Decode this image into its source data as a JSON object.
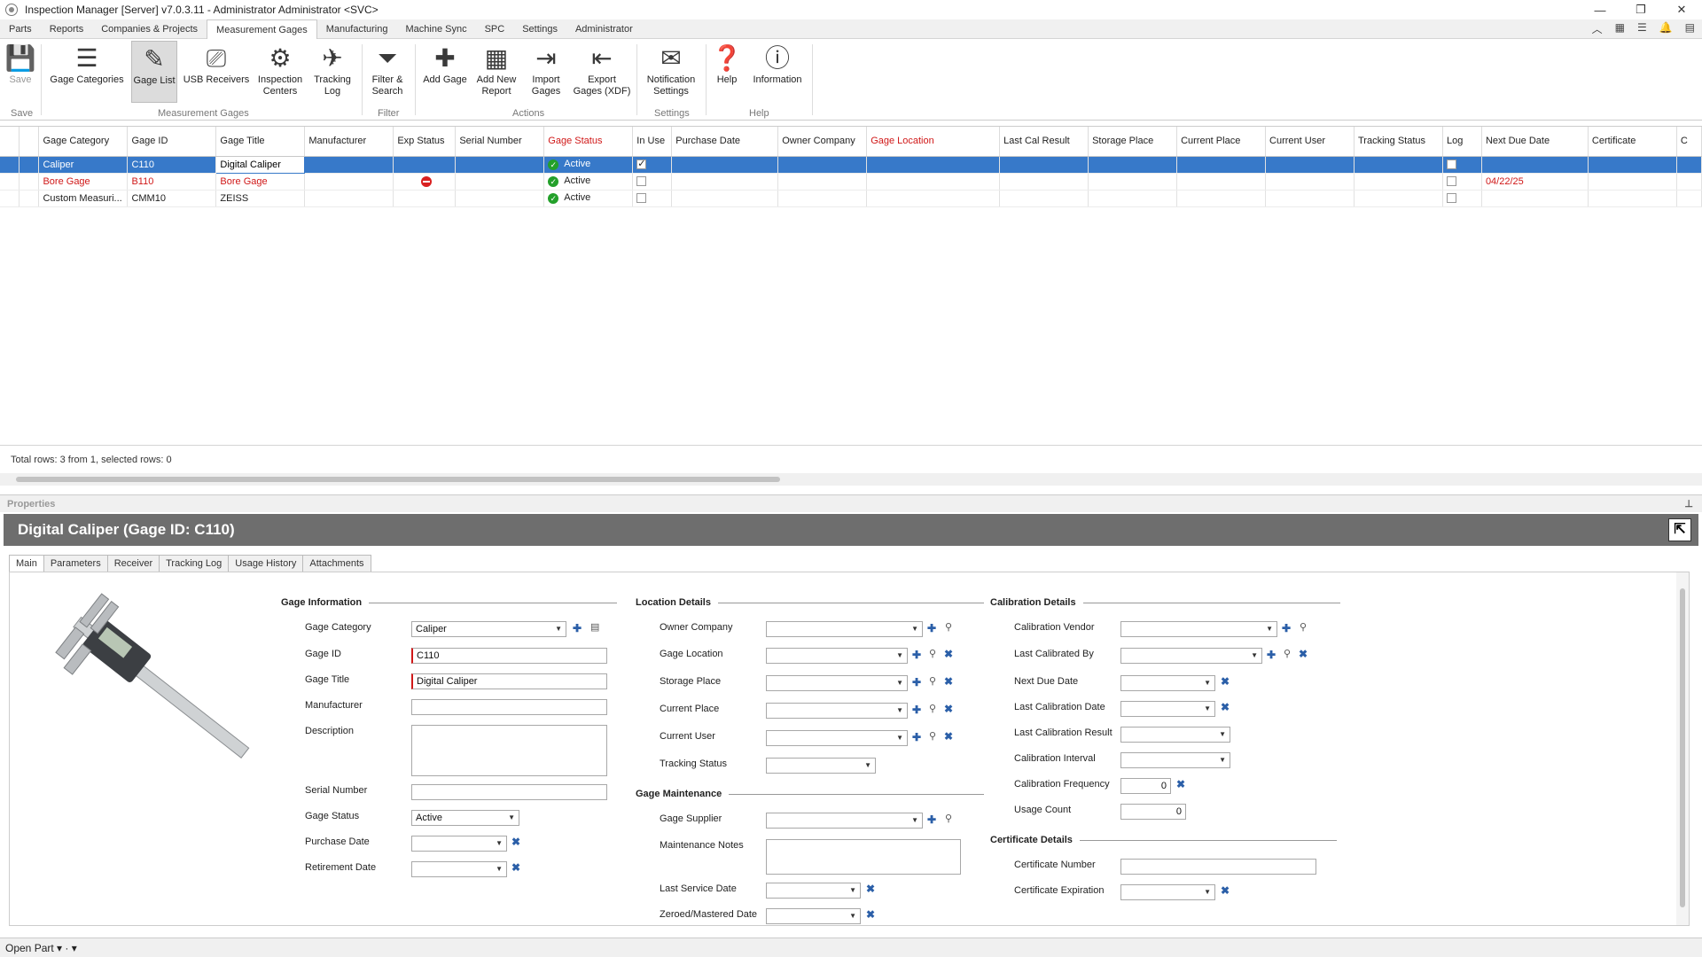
{
  "window": {
    "title": "Inspection Manager [Server] v7.0.3.11 - Administrator Administrator <SVC>",
    "controls": {
      "minimize": "—",
      "restore": "❐",
      "close": "✕"
    }
  },
  "menu": [
    "Parts",
    "Reports",
    "Companies & Projects",
    "Measurement Gages",
    "Manufacturing",
    "Machine Sync",
    "SPC",
    "Settings",
    "Administrator"
  ],
  "menu_active": "Measurement Gages",
  "quick_icons": [
    "︿",
    "▦",
    "☰",
    "🔔",
    "▤"
  ],
  "ribbon": {
    "buttons": {
      "save": "Save",
      "gage_categories": "Gage Categories",
      "gage_list": "Gage List",
      "usb_receivers": "USB Receivers",
      "inspection_centers": "Inspection Centers",
      "tracking_log": "Tracking Log",
      "filter_search": "Filter & Search",
      "add_gage": "Add Gage",
      "add_new_report": "Add New Report",
      "import_gages": "Import Gages",
      "export_gages": "Export Gages (XDF)",
      "notification_settings": "Notification Settings",
      "help": "Help",
      "information": "Information"
    },
    "groups": {
      "save": "Save",
      "measurement_gages": "Measurement Gages",
      "filter": "Filter",
      "actions": "Actions",
      "settings": "Settings",
      "help": "Help"
    }
  },
  "grid": {
    "columns": [
      "Gage Category",
      "Gage ID",
      "Gage Title",
      "Manufacturer",
      "Exp Status",
      "Serial Number",
      "Gage Status",
      "In Use",
      "Purchase Date",
      "Owner Company",
      "Gage Location",
      "Last Cal Result",
      "Storage Place",
      "Current Place",
      "Current User",
      "Tracking Status",
      "Log",
      "Next Due Date",
      "Certificate",
      "C"
    ],
    "rows": [
      {
        "category": "Caliper",
        "id": "C110",
        "title": "Digital Caliper",
        "manufacturer": "",
        "serial": "",
        "status": "Active",
        "in_use": true,
        "log": false,
        "next_due": ""
      },
      {
        "category": "Bore Gage",
        "id": "B110",
        "title": "Bore Gage",
        "manufacturer": "",
        "serial": "",
        "status": "Active",
        "in_use": false,
        "log": false,
        "next_due": "04/22/25"
      },
      {
        "category": "Custom Measuri...",
        "id": "CMM10",
        "title": "ZEISS",
        "manufacturer": "",
        "serial": "",
        "status": "Active",
        "in_use": false,
        "log": false,
        "next_due": ""
      }
    ],
    "footer": "Total rows: 3 from 1, selected rows: 0"
  },
  "properties": {
    "header": "Properties",
    "title": "Digital Caliper (Gage ID: C110)",
    "tabs": [
      "Main",
      "Parameters",
      "Receiver",
      "Tracking Log",
      "Usage History",
      "Attachments"
    ],
    "gage_info": {
      "heading": "Gage Information",
      "category_label": "Gage Category",
      "category_value": "Caliper",
      "id_label": "Gage ID",
      "id_value": "C110",
      "title_label": "Gage Title",
      "title_value": "Digital Caliper",
      "manufacturer_label": "Manufacturer",
      "description_label": "Description",
      "serial_label": "Serial Number",
      "status_label": "Gage Status",
      "status_value": "Active",
      "purchase_label": "Purchase Date",
      "retirement_label": "Retirement Date"
    },
    "location": {
      "heading": "Location Details",
      "owner_company": "Owner Company",
      "gage_location": "Gage Location",
      "storage_place": "Storage Place",
      "current_place": "Current Place",
      "current_user": "Current User",
      "tracking_status": "Tracking Status"
    },
    "maintenance": {
      "heading": "Gage Maintenance",
      "supplier": "Gage Supplier",
      "notes": "Maintenance Notes",
      "last_service": "Last Service Date",
      "zeroed": "Zeroed/Mastered Date"
    },
    "calibration": {
      "heading": "Calibration Details",
      "vendor": "Calibration Vendor",
      "last_by": "Last Calibrated By",
      "next_due": "Next Due Date",
      "last_date": "Last Calibration Date",
      "last_result": "Last Calibration Result",
      "interval": "Calibration Interval",
      "frequency": "Calibration Frequency",
      "frequency_value": "0",
      "usage_count": "Usage Count",
      "usage_value": "0"
    },
    "certificate": {
      "heading": "Certificate Details",
      "number": "Certificate Number",
      "expiration": "Certificate Expiration"
    }
  },
  "statusbar": {
    "open_part": "Open Part ▾ · ▾"
  }
}
